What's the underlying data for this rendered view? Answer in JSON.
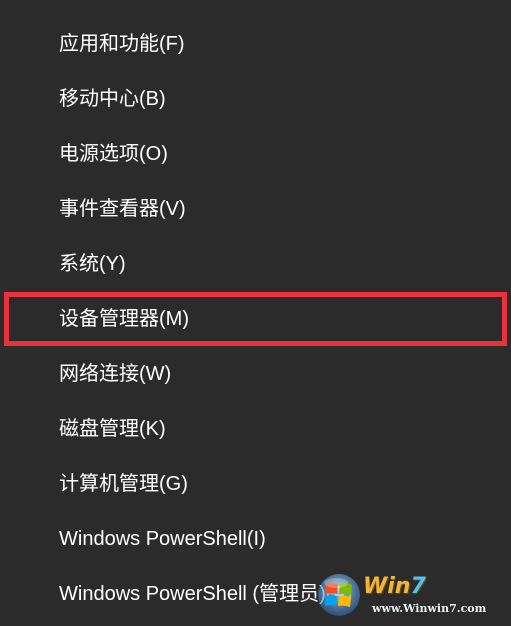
{
  "menu": {
    "items": [
      {
        "label": "应用和功能(F)"
      },
      {
        "label": "移动中心(B)"
      },
      {
        "label": "电源选项(O)"
      },
      {
        "label": "事件查看器(V)"
      },
      {
        "label": "系统(Y)"
      },
      {
        "label": "设备管理器(M)",
        "highlighted": true
      },
      {
        "label": "网络连接(W)"
      },
      {
        "label": "磁盘管理(K)"
      },
      {
        "label": "计算机管理(G)"
      },
      {
        "label": "Windows PowerShell(I)"
      },
      {
        "label": "Windows PowerShell (管理员)(A)"
      }
    ]
  },
  "watermark": {
    "brand": "Win7",
    "brand_main": "Win",
    "brand_digit": "7",
    "url": "www.Winwin7.com"
  },
  "colors": {
    "background": "#2b2b2b",
    "text": "#ffffff",
    "highlight_border": "#e8323b"
  }
}
